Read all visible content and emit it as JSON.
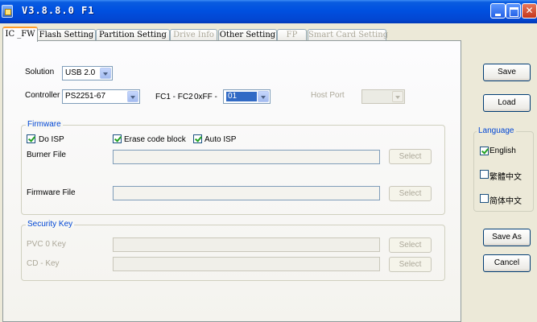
{
  "window": {
    "title": "V3.8.8.0 F1"
  },
  "tabs": [
    {
      "label": "IC _FW",
      "state": "active"
    },
    {
      "label": "Flash Setting",
      "state": "normal"
    },
    {
      "label": "Partition Setting",
      "state": "normal"
    },
    {
      "label": "Drive Info",
      "state": "disabled"
    },
    {
      "label": "Other Setting",
      "state": "normal"
    },
    {
      "label": "FP",
      "state": "disabled"
    },
    {
      "label": "Smart Card Setting",
      "state": "disabled"
    }
  ],
  "solution": {
    "label": "Solution",
    "value": "USB 2.0"
  },
  "controller": {
    "label": "Controller",
    "value": "PS2251-67"
  },
  "fc": {
    "label": "FC1 - FC2",
    "prefix": "0xFF -",
    "value": "01"
  },
  "host_port": {
    "label": "Host Port",
    "value": ""
  },
  "firmware": {
    "title": "Firmware",
    "do_isp": {
      "label": "Do ISP",
      "checked": true
    },
    "erase_code_block": {
      "label": "Erase code block",
      "checked": true
    },
    "auto_isp": {
      "label": "Auto ISP",
      "checked": true
    },
    "burner_file": {
      "label": "Burner File",
      "value": "",
      "button": "Select"
    },
    "firmware_file": {
      "label": "Firmware File",
      "value": "",
      "button": "Select"
    }
  },
  "security_key": {
    "title": "Security Key",
    "pvc0_key": {
      "label": "PVC 0 Key",
      "value": "",
      "button": "Select"
    },
    "cd_key": {
      "label": "CD - Key",
      "value": "",
      "button": "Select"
    }
  },
  "side_buttons": {
    "save": "Save",
    "load": "Load",
    "save_as": "Save As",
    "cancel": "Cancel"
  },
  "language": {
    "title": "Language",
    "options": [
      {
        "label": "English",
        "checked": true
      },
      {
        "label": "繁體中文",
        "checked": false
      },
      {
        "label": "简体中文",
        "checked": false
      }
    ]
  }
}
